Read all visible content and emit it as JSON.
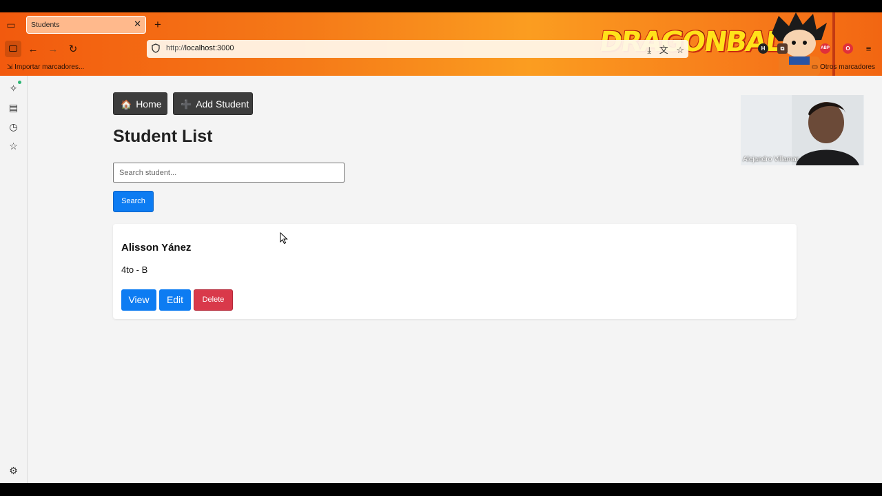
{
  "browser": {
    "tab_title": "Students",
    "url_scheme": "http://",
    "url_host": "localhost:3000",
    "bookmark_import": "Importar marcadores...",
    "bookmark_other": "Otros marcadores",
    "theme_logo": "DRAGONBALL",
    "extensions": [
      "H",
      "ABP",
      "O"
    ]
  },
  "sidebar": {
    "icons": [
      "sparkle-icon",
      "history-panel-icon",
      "clock-icon",
      "star-icon",
      "gear-icon"
    ]
  },
  "nav": {
    "home_label": "Home",
    "add_student_label": "Add Student"
  },
  "page": {
    "title": "Student List"
  },
  "search": {
    "placeholder": "Search student...",
    "button_label": "Search"
  },
  "students": [
    {
      "name": "Alisson Yánez",
      "class": "4to - B",
      "view_label": "View",
      "edit_label": "Edit",
      "delete_label": "Delete"
    }
  ],
  "webcam": {
    "participant_name": "Alejandro Villamar"
  },
  "colors": {
    "primary": "#0d7cf2",
    "danger": "#d9394a",
    "dark_button": "#3d3d3d"
  }
}
